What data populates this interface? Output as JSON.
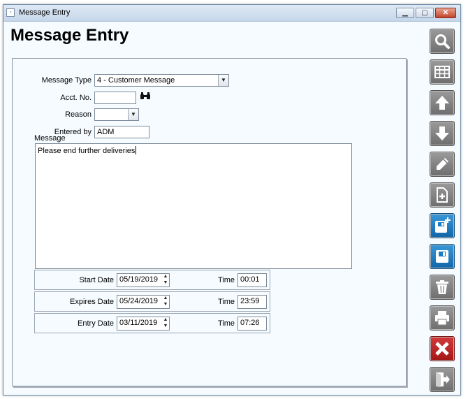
{
  "window": {
    "title": "Message Entry",
    "icon": "app-icon"
  },
  "page_title": "Message Entry",
  "form": {
    "message_type": {
      "label": "Message Type",
      "value": "4 - Customer Message"
    },
    "acct_no": {
      "label": "Acct. No.",
      "value": ""
    },
    "reason": {
      "label": "Reason",
      "value": ""
    },
    "entered_by": {
      "label": "Entered by",
      "value": "ADM"
    },
    "message": {
      "label": "Message",
      "value": "Please end further deliveries"
    }
  },
  "dates": [
    {
      "label": "Start Date",
      "date": "05/19/2019",
      "time_label": "Time",
      "time": "00:01"
    },
    {
      "label": "Expires Date",
      "date": "05/24/2019",
      "time_label": "Time",
      "time": "23:59"
    },
    {
      "label": "Entry Date",
      "date": "03/11/2019",
      "time_label": "Time",
      "time": "07:26"
    }
  ],
  "toolbar": {
    "icons": [
      "search-icon",
      "grid-icon",
      "arrow-up-icon",
      "arrow-down-icon",
      "pencil-icon",
      "new-document-icon",
      "save-new-icon",
      "save-icon",
      "trash-icon",
      "print-icon",
      "close-icon",
      "exit-icon"
    ],
    "accent_gray": "#808080",
    "accent_blue": "#1a7cc2",
    "accent_red": "#c62828"
  }
}
